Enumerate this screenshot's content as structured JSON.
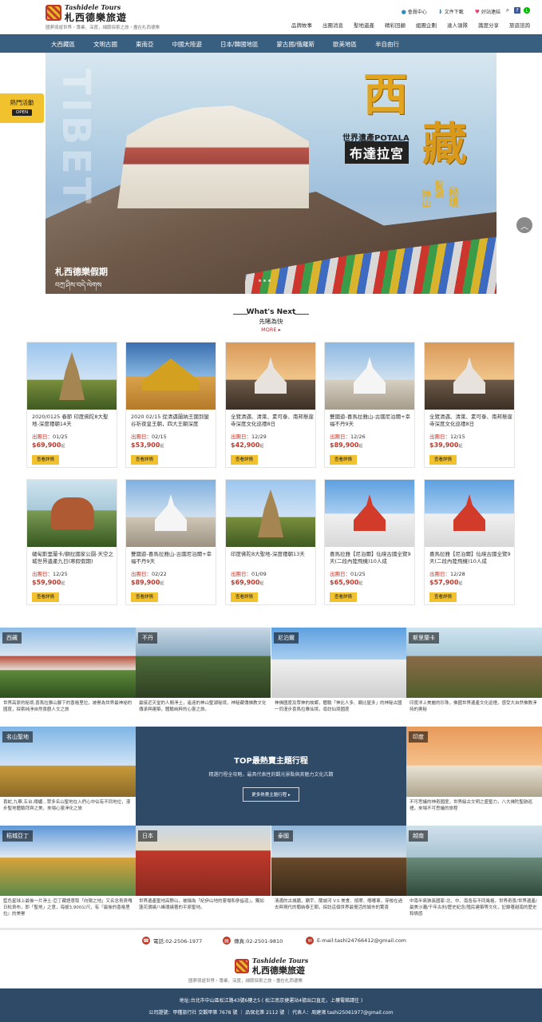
{
  "brand": {
    "name_en": "Tashidele Tours",
    "name_cn": "札西德樂旅遊",
    "tagline": "國夢境遊世界・專業、深度，細節探索之旅・盡在札西德樂"
  },
  "utility": {
    "member": "會員中心",
    "download": "文件下載",
    "links": "好站連結"
  },
  "top_nav": [
    "品牌故事",
    "出團消息",
    "聖地遺產",
    "精彩回顧",
    "組團企劃",
    "達人領隊",
    "識度分享",
    "旅遊諮詢"
  ],
  "main_nav": [
    "大西藏區",
    "文明古國",
    "東南亞",
    "中國大陸遊",
    "日本/韓國地區",
    "蒙古國/俄羅斯",
    "歐美地區",
    "半自由行"
  ],
  "hot": {
    "label": "熱門活動",
    "button": "OPEN"
  },
  "hero": {
    "title_char1": "西",
    "title_char2": "藏",
    "potala_label": "世界遺產POTALA",
    "palace_name": "布達拉宮",
    "side1": "聖湖",
    "side2": "秘境",
    "side3": "神山",
    "brand_overlay": "札西德樂假期",
    "brand_tibetan": "བཀྲ་ཤིས་བདེ་ལེགས"
  },
  "whats_next": {
    "en": "What's Next",
    "cn": "先睹為快",
    "more": "MORE"
  },
  "tours": [
    {
      "title": "2020/0125 春節 印度佛陀8大聖地-深度禮朝14天",
      "date": "01/25",
      "price": "$69,900"
    },
    {
      "title": "2020 02/15 從清邁蘭納王國到蠻谷祈夜皇王朝，四大王朝深度",
      "date": "02/15",
      "price": "$53,900"
    },
    {
      "title": "全覽清邁、清萊、素可泰、南邦懸崖寺深度文化巡禮8日",
      "date": "12/29",
      "price": "$42,900"
    },
    {
      "title": "雙國遊-喜馬拉雅山-古國尼泊爾+幸福不丹9天",
      "date": "12/26",
      "price": "$89,900"
    },
    {
      "title": "全覽清邁、清萊、素可泰、南邦懸崖寺深度文化巡禮8日",
      "date": "12/15",
      "price": "$39,900"
    },
    {
      "title": "緬甸斯里蘭卡/獅拉國家公園-天空之城世界遺產九日(寒假假期)",
      "date": "12/25",
      "price": "$59,900"
    },
    {
      "title": "雙國遊-喜馬拉雅山-古國尼泊爾+幸福不丹9天",
      "date": "02/22",
      "price": "$89,900"
    },
    {
      "title": "印度佛陀8大聖地-深度禮朝13天",
      "date": "01/09",
      "price": "$69,900"
    },
    {
      "title": "喜馬拉雅【尼泊爾】仙境古國全覽9天(二段內陸飛機)10人成",
      "date": "01/25",
      "price": "$65,900"
    },
    {
      "title": "喜馬拉雅【尼泊爾】仙境古國全覽9天(二段內陸飛機)10人成",
      "date": "12/28",
      "price": "$57,900"
    }
  ],
  "tour_labels": {
    "depart": "出團日：",
    "suffix": "起",
    "button": "查看詳情"
  },
  "regions": [
    {
      "name": "西藏",
      "desc": "世界高原的秘境,喜馬拉雅山腳下的香格里拉，被譽為世界最神祕的國度，探索純淨自然景觀人文之旅"
    },
    {
      "name": "不丹",
      "desc": "最接近天堂的人間淨土，遙遠的神山聖湖秘境，神秘藏傳佛教文化傳承與建築，體驗純粹的心靈之旅。"
    },
    {
      "name": "尼泊爾",
      "desc": "神佛國度及眾神的故鄉，體驗「神比人多、廟比屋多」的神秘古國一同漫步喜馬拉雅仙境，尋訪仙境國度"
    },
    {
      "name": "斯里蘭卡",
      "desc": "印度洋上美麗的珍珠，佛國世界遺產文化巡禮，感受大自然佛教淨持的奧秘"
    },
    {
      "name": "名山聖地",
      "desc": "喜蛇,九華,五台,峨嵋…眾多名山聖地在入們心中佔有不同地位，漫步聖地體驗拜與之美，來場心靈淨化之旅"
    },
    {
      "name": "印度",
      "desc": "不可思議的神奇國度，世界級古文明之盛聖力，八大佛陀聖跡巡禮，來場不可思議的旅程"
    },
    {
      "name": "稻城亞丁",
      "desc": "藍色星球上最後一片淨土-亞丁藏語意取「向陽之地」又名念青貢嘎日松貢布，即「聖地」之意，海拔3,900公尺，有『最後的香格里拉』的美譽"
    },
    {
      "name": "日本",
      "desc": "世界遺產聖地高野山，被稱為「紀伊山地的靈場和參詣道」，獨如蓮花環繞八峰環繞著的平原聖地。"
    },
    {
      "name": "泰國",
      "desc": "清邁的古城牆，廟宇、蘭城河 V.S 美食、按摩、嘟嘟車，穿梭在過去與現代的蘭納泰王朝，探訪這個世界最慢活的城市的驚喜"
    },
    {
      "name": "越南",
      "desc": "中南半島狹長國家-北、中、南各有不同風格，世界奇景/世界遺產/最美沙灘/千年古刹/歷史紀念/殖民建築等文化，記錄著越南的歷史和情感"
    }
  ],
  "top_section": {
    "heading": "TOP最熱賣主題行程",
    "sub": "精選行程全攻略，最具代表性的觀光景點與其魅力文化古蹟",
    "button": "更多熱賣主題行程"
  },
  "contact": {
    "phone": "電話:02-2506-1977",
    "fax": "傳真:02-2501-9810",
    "email": "E-mail:tashi24766412@gmail.com"
  },
  "footer": {
    "address": "地址:台北市中山區松江路43號6樓之5 ( 松江南京捷運站4號出口直走，上樓電梯請往 )",
    "license": "公司證號：甲種旅行社 交觀甲第 7678 號  ｜  品保北第 2112 號  ｜  代表人：周建鴻 tashi25061977@gmail.com"
  },
  "colors": {
    "nav": "#395f80",
    "accent": "#f2c12e",
    "price": "#c0392b",
    "footer": "#2f4a66"
  }
}
